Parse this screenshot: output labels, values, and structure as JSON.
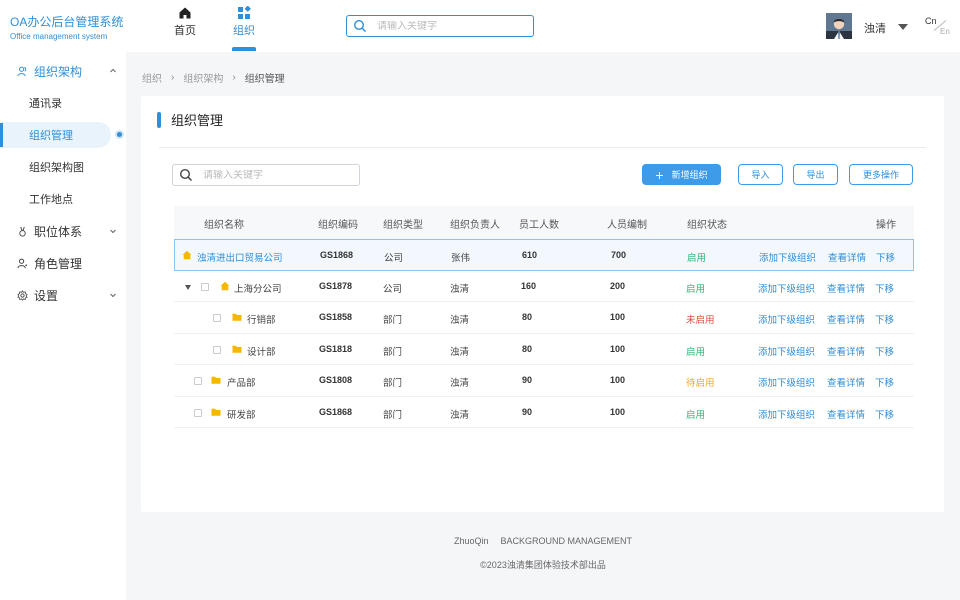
{
  "app": {
    "title": "OA办公后台管理系统",
    "subtitle": "Office management system"
  },
  "sidebar": {
    "groups": [
      {
        "label": "组织架构",
        "icon": "people-icon",
        "expanded": true
      },
      {
        "label": "职位体系",
        "icon": "medal-icon",
        "expanded": false
      },
      {
        "label": "角色管理",
        "icon": "user-icon",
        "expanded": false
      },
      {
        "label": "设置",
        "icon": "gear-icon",
        "expanded": false
      }
    ],
    "sub_items": [
      {
        "label": "通讯录",
        "active": false
      },
      {
        "label": "组织管理",
        "active": true
      },
      {
        "label": "组织架构图",
        "active": false
      },
      {
        "label": "工作地点",
        "active": false
      }
    ]
  },
  "topbar": {
    "tabs": [
      {
        "label": "首页",
        "icon": "home-icon",
        "active": false
      },
      {
        "label": "组织",
        "icon": "grid-icon",
        "active": true
      }
    ],
    "search_placeholder": "请输入关键字",
    "user_name": "浊清",
    "lang_primary": "Cn",
    "lang_secondary": "En"
  },
  "breadcrumb": [
    "组织",
    "组织架构",
    "组织管理"
  ],
  "card": {
    "title": "组织管理",
    "search_placeholder": "请输入关键字",
    "buttons": {
      "add": "新增组织",
      "import": "导入",
      "export": "导出",
      "more": "更多操作"
    }
  },
  "table": {
    "headers": [
      "组织名称",
      "组织编码",
      "组织类型",
      "组织负责人",
      "员工人数",
      "人员编制",
      "组织状态",
      "操作"
    ],
    "actions": [
      "添加下级组织",
      "查看详情",
      "下移"
    ],
    "rows": [
      {
        "name": "浊清进出口贸易公司",
        "code": "GS1868",
        "type": "公司",
        "owner": "张伟",
        "staff": "610",
        "quota": "700",
        "status": "启用",
        "status_color": "#2bb673",
        "icon": "house-icon",
        "level": 0,
        "checkbox": false,
        "expand": false,
        "highlight": true
      },
      {
        "name": "上海分公司",
        "code": "GS1878",
        "type": "公司",
        "owner": "浊清",
        "staff": "160",
        "quota": "200",
        "status": "启用",
        "status_color": "#2bb673",
        "icon": "house-icon",
        "level": 1,
        "checkbox": true,
        "expand": true,
        "highlight": false
      },
      {
        "name": "行销部",
        "code": "GS1858",
        "type": "部门",
        "owner": "浊清",
        "staff": "80",
        "quota": "100",
        "status": "未启用",
        "status_color": "#e54d42",
        "icon": "folder-icon",
        "level": 2,
        "checkbox": true,
        "expand": false,
        "highlight": false
      },
      {
        "name": "设计部",
        "code": "GS1818",
        "type": "部门",
        "owner": "浊清",
        "staff": "80",
        "quota": "100",
        "status": "启用",
        "status_color": "#2bb673",
        "icon": "folder-icon",
        "level": 2,
        "checkbox": true,
        "expand": false,
        "highlight": false
      },
      {
        "name": "产品部",
        "code": "GS1808",
        "type": "部门",
        "owner": "浊清",
        "staff": "90",
        "quota": "100",
        "status": "待启用",
        "status_color": "#f5a623",
        "icon": "folder-icon",
        "level": 1,
        "checkbox": true,
        "expand": false,
        "highlight": false
      },
      {
        "name": "研发部",
        "code": "GS1868",
        "type": "部门",
        "owner": "浊清",
        "staff": "90",
        "quota": "100",
        "status": "启用",
        "status_color": "#2bb673",
        "icon": "folder-icon",
        "level": 1,
        "checkbox": true,
        "expand": false,
        "highlight": false
      }
    ]
  },
  "footer": {
    "brand": "ZhuoQin",
    "tagline": "BACKGROUND MANAGEMENT",
    "copyright": "©2023浊清集团体验技术部出品"
  }
}
